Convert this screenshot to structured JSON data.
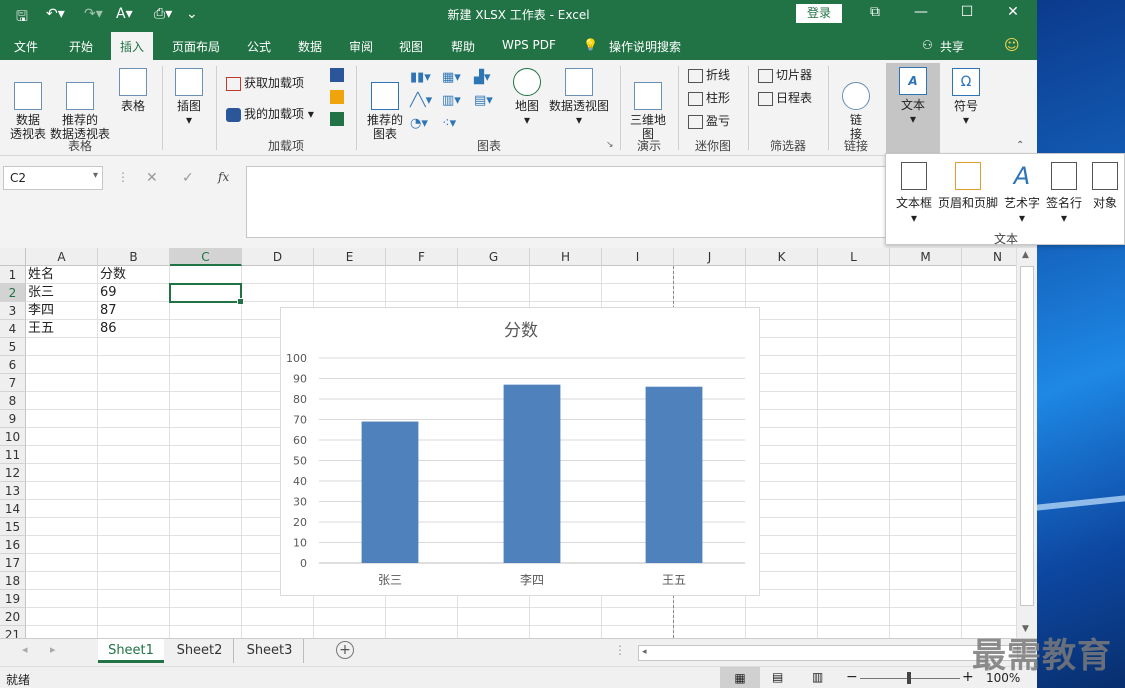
{
  "window": {
    "title": "新建 XLSX 工作表  -  Excel",
    "login_label": "登录",
    "minimize": "—",
    "maximize": "☐",
    "close": "✕",
    "restore": "⧉"
  },
  "tabs": [
    {
      "label": "文件"
    },
    {
      "label": "开始"
    },
    {
      "label": "插入"
    },
    {
      "label": "页面布局"
    },
    {
      "label": "公式"
    },
    {
      "label": "数据"
    },
    {
      "label": "审阅"
    },
    {
      "label": "视图"
    },
    {
      "label": "帮助"
    },
    {
      "label": "WPS PDF"
    },
    {
      "label": "操作说明搜索"
    }
  ],
  "share_label": "共享",
  "ribbon": {
    "pivot_table": "数据\n透视表",
    "recommended_pivot": "推荐的\n数据透视表",
    "table": "表格",
    "illustrations": "插图",
    "get_addins": "获取加载项",
    "my_addins": "我的加载项",
    "recommended_charts": "推荐的\n图表",
    "maps": "地图",
    "pivot_chart": "数据透视图",
    "3d_map": "三维地\n图",
    "line": "折线",
    "column": "柱形",
    "win_loss": "盈亏",
    "slicer": "切片器",
    "timeline": "日程表",
    "link": "链\n接",
    "text": "文本",
    "symbols": "符号",
    "groups": {
      "tables": "表格",
      "addins": "加载项",
      "charts": "图表",
      "tours": "演示",
      "sparklines": "迷你图",
      "filters": "筛选器",
      "links": "链接"
    }
  },
  "text_popup": {
    "items": [
      "文本框",
      "页眉和页脚",
      "艺术字",
      "签名行",
      "对象"
    ],
    "group_label": "文本"
  },
  "formula_bar": {
    "name_box": "C2",
    "fx": "fx",
    "value": ""
  },
  "columns": [
    "A",
    "B",
    "C",
    "D",
    "E",
    "F",
    "G",
    "H",
    "I",
    "J",
    "K",
    "L",
    "M",
    "N"
  ],
  "rows": [
    "1",
    "2",
    "3",
    "4",
    "5",
    "6",
    "7",
    "8",
    "9",
    "10",
    "11",
    "12",
    "13",
    "14",
    "15",
    "16",
    "17",
    "18",
    "19",
    "20",
    "21"
  ],
  "cells": {
    "A1": "姓名",
    "B1": "分数",
    "A2": "张三",
    "B2": "69",
    "A3": "李四",
    "B3": "87",
    "A4": "王五",
    "B4": "86"
  },
  "chart_data": {
    "type": "bar",
    "title": "分数",
    "categories": [
      "张三",
      "李四",
      "王五"
    ],
    "values": [
      69,
      87,
      86
    ],
    "ylim": [
      0,
      100
    ],
    "yticks": [
      0,
      10,
      20,
      30,
      40,
      50,
      60,
      70,
      80,
      90,
      100
    ],
    "grid": true,
    "bar_color": "#4f81bd",
    "xlabel": "",
    "ylabel": ""
  },
  "sheets": [
    {
      "label": "Sheet1",
      "active": true
    },
    {
      "label": "Sheet2",
      "active": false
    },
    {
      "label": "Sheet3",
      "active": false
    }
  ],
  "status": {
    "ready": "就绪",
    "zoom": "100%"
  },
  "watermark": "最需教育",
  "colors": {
    "accent": "#217346",
    "bar": "#4f81bd"
  }
}
